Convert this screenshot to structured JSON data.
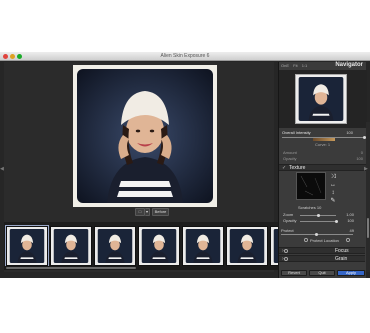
{
  "window": {
    "title": "Alien Skin Exposure 6"
  },
  "viewer": {
    "mode_label": "□",
    "before_label": "Before"
  },
  "navigator": {
    "tabs": [
      "OnE",
      "Fit",
      "1:1"
    ],
    "title": "Navigator"
  },
  "adjustments": {
    "overall_intensity": {
      "label": "Overall Intensity",
      "value": "100",
      "fraction": 1.0
    },
    "curve_label": "Curve: 1",
    "amount": {
      "label": "Amount",
      "value": "0",
      "fraction": 0.0
    },
    "opacity": {
      "label": "Opacity",
      "value": "100",
      "fraction": 1.0
    }
  },
  "texture": {
    "section_title": "Texture",
    "name": "Scratches 10",
    "zoom": {
      "label": "Zoom",
      "value": "1.00",
      "fraction": 0.5
    },
    "opacity": {
      "label": "Opacity",
      "value": "100",
      "fraction": 1.0
    },
    "icons": [
      "shuffle-icon",
      "flip-horizontal-icon",
      "flip-vertical-icon",
      "brush-icon"
    ]
  },
  "protect": {
    "label": "Protect",
    "value": "49",
    "fraction": 0.49,
    "location_label": "Protect Location"
  },
  "focus": {
    "title": "Focus"
  },
  "grain": {
    "title": "Grain"
  },
  "buttons": {
    "revert": "Revert",
    "quit": "Quit",
    "apply": "Apply"
  },
  "filmstrip": {
    "count": 7,
    "selected_index": 0
  },
  "colors": {
    "accent": "#3566c8",
    "panel": "#3b3b3b",
    "canvas": "#2b2b2b"
  }
}
